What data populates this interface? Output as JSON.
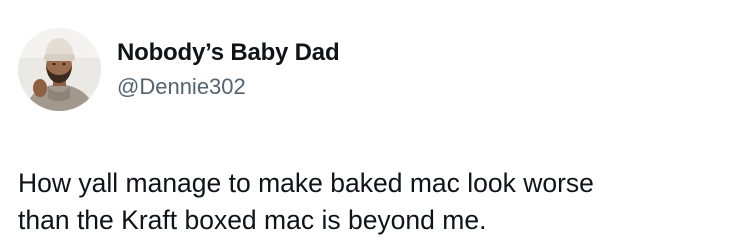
{
  "author": {
    "display_name": "Nobody’s Baby Dad",
    "handle": "@Dennie302",
    "avatar_icon": "profile-photo-man-beanie"
  },
  "tweet": {
    "lines": [
      "How yall manage to make baked mac look worse",
      "than the Kraft boxed mac is beyond me."
    ]
  },
  "colors": {
    "text_primary": "#0f1419",
    "text_secondary": "#536471",
    "background": "#ffffff"
  }
}
